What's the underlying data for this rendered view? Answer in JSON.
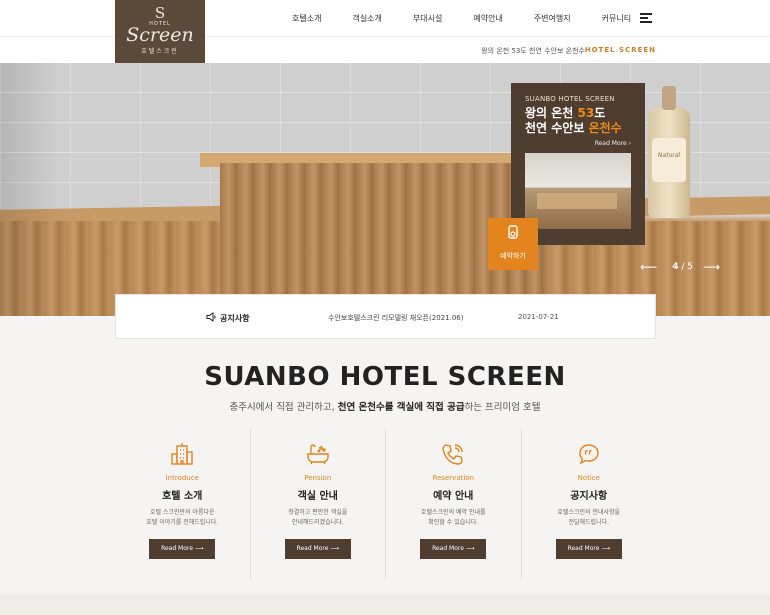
{
  "logo": {
    "s": "S",
    "hotel": "HOTEL",
    "script": "Screen",
    "kr": "호텔스크린"
  },
  "nav": [
    "호텔소개",
    "객실소개",
    "부대시설",
    "예약안내",
    "주변여행지",
    "커뮤니티"
  ],
  "subbar": {
    "text": "왕의 온천 53도 천연 수안보 온천수",
    "brand": "HOTEL SCREEN"
  },
  "hero": {
    "bottle_label": "Natural",
    "promo": {
      "kicker": "SUANBO HOTEL SCREEN",
      "line1_a": "왕의 온천 ",
      "line1_hl": "53",
      "line1_b": "도",
      "line2_a": "천연 수안보 ",
      "line2_hl": "온천수",
      "more": "Read More",
      "chevron": "›"
    },
    "reserve": {
      "label": "예약하기",
      "icon": "reservation-icon"
    },
    "slider": {
      "current": "4",
      "sep": "/",
      "total": "5",
      "prev": "⟵",
      "next": "⟶"
    }
  },
  "notice": {
    "label": "공지사항",
    "title": "수안보호텔스크린 리모델링 재오픈(2021.06)",
    "date": "2021-07-21"
  },
  "section": {
    "title": "SUANBO HOTEL SCREEN",
    "sub_a": "충주시에서 직접 관리하고, ",
    "sub_b": "천연 온천수를 객실에 직접 공급",
    "sub_c": "하는 프리미엄 호텔"
  },
  "cards": [
    {
      "en": "Introduce",
      "ko": "호텔 소개",
      "desc1": "호텔 스크린만의 아름다운",
      "desc2": "호텔 이야기를 전해드립니다.",
      "btn": "Read More ⟶",
      "icon": "building-icon"
    },
    {
      "en": "Pension",
      "ko": "객실 안내",
      "desc1": "청결하고 편안한 객실을",
      "desc2": "안내해드리겠습니다.",
      "btn": "Read More ⟶",
      "icon": "bathtub-icon"
    },
    {
      "en": "Reservation",
      "ko": "예약 안내",
      "desc1": "호텔스크린의 예약 안내를",
      "desc2": "확인할 수 있습니다.",
      "btn": "Read More ⟶",
      "icon": "phone-icon"
    },
    {
      "en": "Notice",
      "ko": "공지사항",
      "desc1": "호텔스크린의 안내사항을",
      "desc2": "전달해드립니다.",
      "btn": "Read More ⟶",
      "icon": "speech-bubble-icon"
    }
  ],
  "colors": {
    "brown": "#4f3e30",
    "accent": "#e3841f"
  }
}
